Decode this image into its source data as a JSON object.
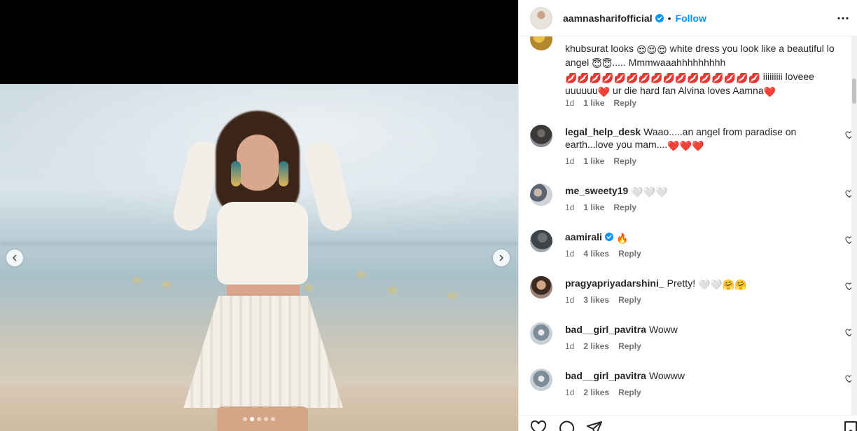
{
  "header": {
    "username": "aamnasharifofficial",
    "separator": "•",
    "follow_label": "Follow",
    "verified_icon": "verified-badge-icon",
    "more_icon": "more-options-icon"
  },
  "carousel": {
    "dot_count": 5,
    "active_index": 1,
    "prev_icon": "chevron-left-icon",
    "next_icon": "chevron-right-icon"
  },
  "comments": [
    {
      "username": "",
      "text_parts": [
        "khubsurat looks ",
        "😍😍😍",
        " white dress you look like a beautiful lo angel ",
        "😇😇",
        "..... Mmmwaaahhhhhhhhh ",
        "💋💋💋💋💋💋💋💋💋💋💋💋💋💋💋💋",
        " iiiiiiiii loveee uuuuuu",
        "❤️",
        " ur die hard fan Alvina loves Aamna",
        "❤️"
      ],
      "time": "1d",
      "likes": "1 like",
      "reply": "Reply"
    },
    {
      "username": "legal_help_desk",
      "text": "Waao.....an angel from paradise on earth...love you mam....",
      "emoji": "❤️❤️❤️",
      "time": "1d",
      "likes": "1 like",
      "reply": "Reply"
    },
    {
      "username": "me_sweety19",
      "text": "",
      "emoji": "🤍🤍🤍",
      "time": "1d",
      "likes": "1 like",
      "reply": "Reply"
    },
    {
      "username": "aamirali",
      "text": "",
      "emoji": "🔥",
      "verified": true,
      "time": "1d",
      "likes": "4 likes",
      "reply": "Reply"
    },
    {
      "username": "pragyapriyadarshini_",
      "text": "Pretty!",
      "emoji": "🤍🤍🤗🤗",
      "time": "1d",
      "likes": "3 likes",
      "reply": "Reply"
    },
    {
      "username": "bad__girl_pavitra",
      "text": "Woww",
      "emoji": "",
      "time": "1d",
      "likes": "2 likes",
      "reply": "Reply"
    },
    {
      "username": "bad__girl_pavitra",
      "text": "Wowww",
      "emoji": "",
      "time": "1d",
      "likes": "2 likes",
      "reply": "Reply"
    }
  ],
  "actions": {
    "like_icon": "heart-icon",
    "comment_icon": "comment-icon",
    "share_icon": "share-icon",
    "save_icon": "bookmark-icon"
  },
  "colors": {
    "link_blue": "#0095f6",
    "text": "#262626",
    "meta_gray": "#737373",
    "heart_red": "#ed4956"
  }
}
